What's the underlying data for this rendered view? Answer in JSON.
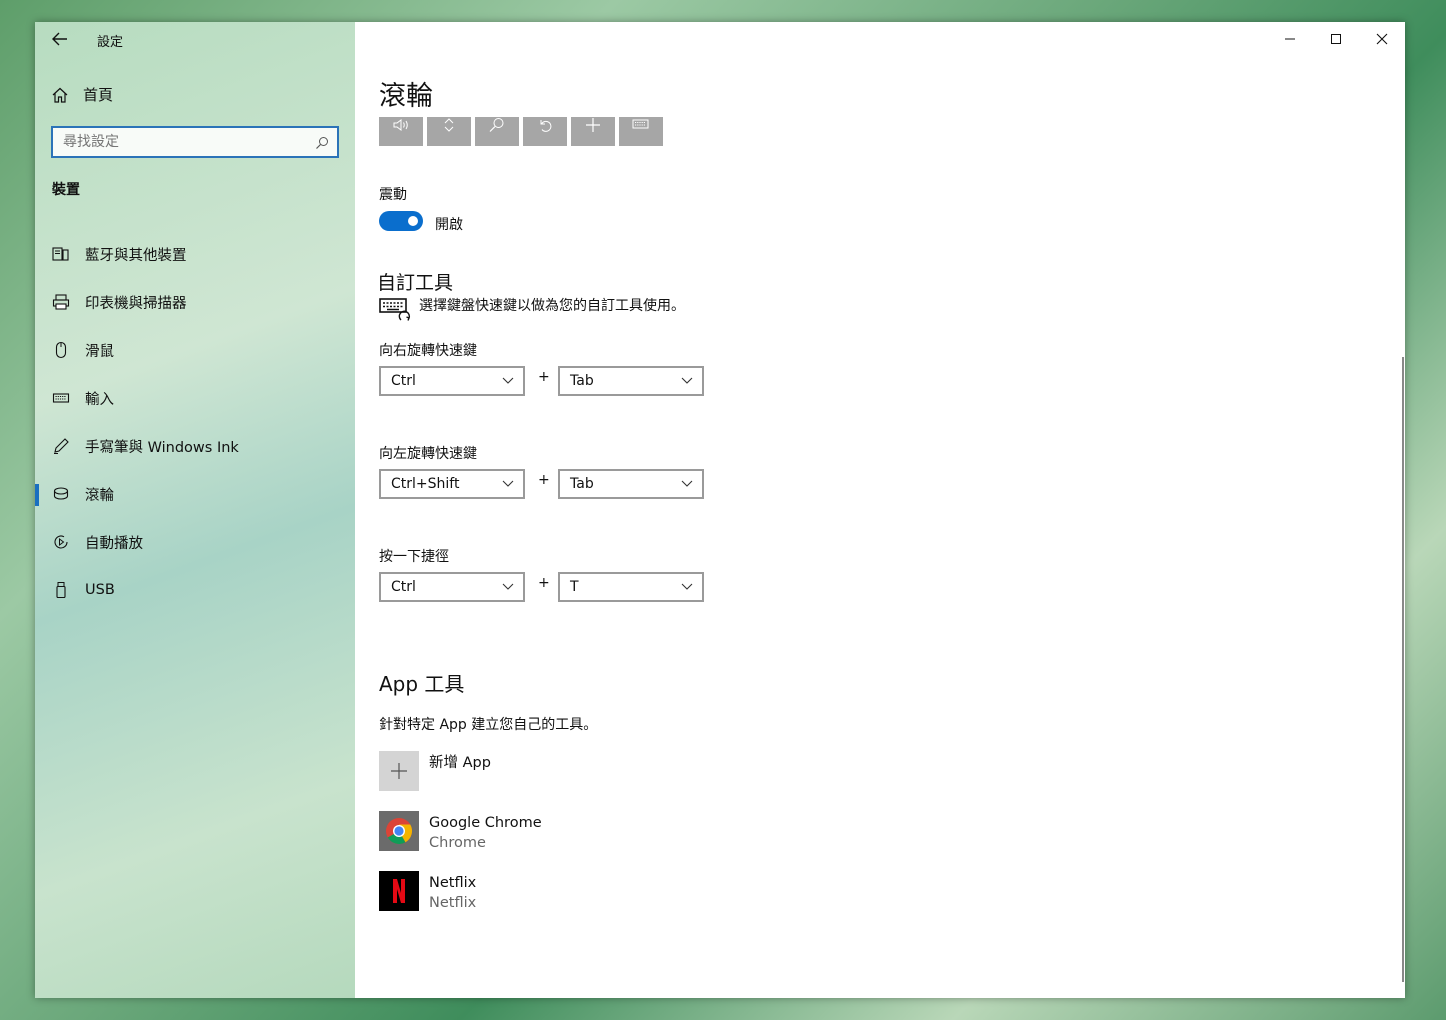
{
  "window": {
    "app_title": "設定"
  },
  "sidebar": {
    "home_label": "首頁",
    "search_placeholder": "尋找設定",
    "section_label": "裝置",
    "items": [
      {
        "label": "藍牙與其他裝置",
        "icon": "bluetooth-devices-icon"
      },
      {
        "label": "印表機與掃描器",
        "icon": "printer-icon"
      },
      {
        "label": "滑鼠",
        "icon": "mouse-icon"
      },
      {
        "label": "輸入",
        "icon": "keyboard-icon"
      },
      {
        "label": "手寫筆與 Windows Ink",
        "icon": "pen-icon"
      },
      {
        "label": "滾輪",
        "icon": "dial-icon",
        "active": true
      },
      {
        "label": "自動播放",
        "icon": "autoplay-icon"
      },
      {
        "label": "USB",
        "icon": "usb-icon"
      }
    ]
  },
  "main": {
    "title": "滾輪",
    "toolbar_icons": [
      "volume-icon",
      "scroll-icon",
      "zoom-icon",
      "undo-icon",
      "add-icon",
      "custom-keyboard-icon"
    ],
    "vibration": {
      "label": "震動",
      "state_label": "開啟",
      "on": true
    },
    "custom_tool": {
      "heading": "自訂工具",
      "description": "選擇鍵盤快速鍵以做為您的自訂工具使用。",
      "shortcuts": [
        {
          "label": "向右旋轉快速鍵",
          "modifier": "Ctrl",
          "key": "Tab"
        },
        {
          "label": "向左旋轉快速鍵",
          "modifier": "Ctrl+Shift",
          "key": "Tab"
        },
        {
          "label": "按一下捷徑",
          "modifier": "Ctrl",
          "key": "T"
        }
      ],
      "plus": "+"
    },
    "app_tools": {
      "heading": "App 工具",
      "description": "針對特定 App 建立您自己的工具。",
      "add_label": "新增 App",
      "apps": [
        {
          "name": "Google Chrome",
          "sub": "Chrome"
        },
        {
          "name": "Netflix",
          "sub": "Netflix"
        }
      ]
    }
  },
  "colors": {
    "accent": "#0a6ecd",
    "toolbar_button": "#a6a6a6",
    "netflix_red": "#e50914"
  }
}
